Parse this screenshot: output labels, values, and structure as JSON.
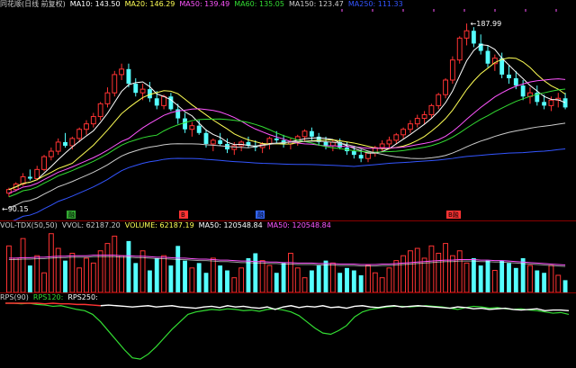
{
  "main_header": {
    "title": "同花顺(日线 前复权)",
    "indicators": [
      {
        "label": "MA10: 143.50",
        "color": "#ffffff"
      },
      {
        "label": "MA20: 146.29",
        "color": "#ffff55"
      },
      {
        "label": "MA50: 139.49",
        "color": "#ff55ff"
      },
      {
        "label": "MA60: 135.05",
        "color": "#33dd33"
      },
      {
        "label": "MA150: 123.47",
        "color": "#cccccc"
      },
      {
        "label": "MA250: 111.33",
        "color": "#3355ff"
      }
    ]
  },
  "price_labels": {
    "high": "187.99",
    "low": "90.15"
  },
  "markers": [
    {
      "label": "融",
      "color": "#33aa33"
    },
    {
      "label": "B",
      "color": "#ff3333"
    },
    {
      "label": "融",
      "color": "#3366ff"
    },
    {
      "label": "B融",
      "color": "#ff3333"
    }
  ],
  "vol_header": [
    {
      "label": "VOL-TDX(50,50)",
      "color": "#cccccc"
    },
    {
      "label": "VVOL: 62187.20",
      "color": "#cccccc"
    },
    {
      "label": "VOLUME: 62187.19",
      "color": "#ffff55"
    },
    {
      "label": "MA50: 120548.84",
      "color": "#ffffff"
    },
    {
      "label": "MA50: 120548.84",
      "color": "#ff55ff"
    }
  ],
  "rps_header": [
    {
      "label": "RPS(90)",
      "color": "#cccccc"
    },
    {
      "label": "RPS120:",
      "color": "#33dd33"
    },
    {
      "label": "RPS250:",
      "color": "#ffffff"
    }
  ],
  "colors": {
    "up": "#ff3333",
    "down": "#55ffff",
    "separator": "#8b0000"
  },
  "chart_data": {
    "type": "candlestick",
    "ylim": [
      85,
      192
    ],
    "candles": [
      [
        95,
        98,
        93,
        97
      ],
      [
        97,
        101,
        96,
        100
      ],
      [
        100,
        106,
        99,
        104
      ],
      [
        104,
        108,
        102,
        103
      ],
      [
        103,
        110,
        102,
        108
      ],
      [
        108,
        116,
        107,
        115
      ],
      [
        115,
        120,
        113,
        118
      ],
      [
        118,
        125,
        116,
        123
      ],
      [
        123,
        128,
        120,
        121
      ],
      [
        121,
        126,
        119,
        125
      ],
      [
        125,
        131,
        123,
        130
      ],
      [
        130,
        135,
        127,
        133
      ],
      [
        133,
        139,
        131,
        137
      ],
      [
        137,
        145,
        135,
        144
      ],
      [
        144,
        153,
        142,
        150
      ],
      [
        150,
        162,
        148,
        160
      ],
      [
        160,
        166,
        157,
        163
      ],
      [
        163,
        166,
        153,
        155
      ],
      [
        155,
        158,
        148,
        150
      ],
      [
        150,
        155,
        146,
        152
      ],
      [
        152,
        156,
        145,
        147
      ],
      [
        147,
        151,
        141,
        143
      ],
      [
        143,
        149,
        141,
        148
      ],
      [
        148,
        150,
        140,
        141
      ],
      [
        141,
        144,
        133,
        136
      ],
      [
        136,
        139,
        128,
        130
      ],
      [
        130,
        134,
        126,
        132
      ],
      [
        132,
        135,
        127,
        128
      ],
      [
        128,
        130,
        120,
        122
      ],
      [
        122,
        125,
        118,
        124
      ],
      [
        124,
        128,
        121,
        122
      ],
      [
        122,
        125,
        117,
        119
      ],
      [
        119,
        123,
        116,
        121
      ],
      [
        121,
        124,
        118,
        123
      ],
      [
        123,
        126,
        120,
        121
      ],
      [
        121,
        124,
        118,
        120
      ],
      [
        120,
        123,
        117,
        122
      ],
      [
        122,
        126,
        119,
        125
      ],
      [
        125,
        129,
        122,
        124
      ],
      [
        124,
        127,
        120,
        122
      ],
      [
        122,
        125,
        119,
        123
      ],
      [
        123,
        127,
        121,
        126
      ],
      [
        126,
        130,
        123,
        129
      ],
      [
        129,
        131,
        124,
        126
      ],
      [
        126,
        128,
        121,
        123
      ],
      [
        123,
        126,
        119,
        121
      ],
      [
        121,
        124,
        118,
        123
      ],
      [
        123,
        125,
        119,
        120
      ],
      [
        120,
        123,
        116,
        118
      ],
      [
        118,
        121,
        114,
        116
      ],
      [
        116,
        119,
        112,
        114
      ],
      [
        114,
        118,
        112,
        117
      ],
      [
        117,
        121,
        115,
        120
      ],
      [
        120,
        124,
        118,
        122
      ],
      [
        122,
        126,
        120,
        124
      ],
      [
        124,
        128,
        122,
        127
      ],
      [
        127,
        131,
        125,
        130
      ],
      [
        130,
        135,
        128,
        133
      ],
      [
        133,
        138,
        131,
        136
      ],
      [
        136,
        140,
        133,
        138
      ],
      [
        138,
        144,
        136,
        143
      ],
      [
        143,
        150,
        141,
        149
      ],
      [
        149,
        158,
        147,
        157
      ],
      [
        157,
        170,
        155,
        168
      ],
      [
        168,
        181,
        166,
        180
      ],
      [
        180,
        188,
        176,
        184
      ],
      [
        184,
        186,
        175,
        177
      ],
      [
        177,
        182,
        171,
        173
      ],
      [
        173,
        176,
        164,
        166
      ],
      [
        166,
        171,
        162,
        169
      ],
      [
        169,
        172,
        158,
        160
      ],
      [
        160,
        165,
        155,
        158
      ],
      [
        158,
        162,
        152,
        154
      ],
      [
        154,
        157,
        146,
        148
      ],
      [
        148,
        153,
        144,
        150
      ],
      [
        150,
        154,
        143,
        145
      ],
      [
        145,
        149,
        141,
        143
      ],
      [
        143,
        148,
        140,
        146
      ],
      [
        146,
        150,
        142,
        147
      ],
      [
        147,
        150,
        141,
        142
      ]
    ],
    "volume": [
      95,
      70,
      110,
      55,
      75,
      40,
      120,
      90,
      65,
      80,
      50,
      70,
      60,
      85,
      100,
      115,
      75,
      105,
      60,
      85,
      45,
      70,
      75,
      55,
      95,
      65,
      50,
      60,
      40,
      70,
      55,
      45,
      30,
      50,
      70,
      80,
      65,
      55,
      40,
      60,
      80,
      50,
      30,
      45,
      55,
      65,
      60,
      40,
      50,
      45,
      35,
      55,
      40,
      30,
      50,
      65,
      75,
      85,
      90,
      70,
      95,
      80,
      100,
      75,
      85,
      60,
      70,
      55,
      65,
      45,
      65,
      60,
      50,
      70,
      55,
      45,
      40,
      55,
      35,
      25
    ],
    "vol_ma": [
      70,
      70,
      71,
      71,
      72,
      72,
      73,
      74,
      74,
      75,
      75,
      75,
      76,
      76,
      76,
      76,
      75,
      75,
      74,
      74,
      73,
      72,
      72,
      71,
      70,
      70,
      69,
      68,
      68,
      67,
      66,
      66,
      65,
      64,
      64,
      63,
      63,
      62,
      62,
      61,
      61,
      60,
      60,
      60,
      59,
      59,
      59,
      58,
      58,
      58,
      57,
      57,
      57,
      58,
      58,
      59,
      60,
      61,
      62,
      63,
      64,
      65,
      66,
      66,
      67,
      67,
      67,
      66,
      66,
      65,
      65,
      64,
      63,
      62,
      61,
      60,
      59,
      58,
      57,
      56
    ],
    "rps120": [
      100,
      100,
      99,
      100,
      98,
      97,
      95,
      96,
      93,
      90,
      88,
      82,
      70,
      55,
      40,
      25,
      12,
      10,
      18,
      30,
      44,
      58,
      70,
      82,
      86,
      88,
      90,
      89,
      91,
      90,
      88,
      89,
      87,
      90,
      91,
      89,
      86,
      80,
      70,
      60,
      52,
      50,
      56,
      64,
      78,
      86,
      90,
      92,
      94,
      95,
      95,
      94,
      95,
      96,
      95,
      94,
      92,
      90,
      93,
      95,
      94,
      92,
      93,
      91,
      90,
      91,
      89,
      88,
      86,
      84,
      85,
      82
    ],
    "rps250": [
      100,
      100,
      100,
      100,
      100,
      99,
      100,
      99,
      99,
      98,
      98,
      97,
      96,
      97,
      96,
      95,
      94,
      95,
      96,
      94,
      95,
      96,
      94,
      93,
      92,
      94,
      95,
      93,
      96,
      94,
      95,
      93,
      92,
      94,
      90,
      94,
      96,
      93,
      95,
      94,
      96,
      93,
      94,
      92,
      95,
      96,
      94,
      93,
      95,
      96,
      94,
      95,
      96,
      95,
      94,
      93,
      92,
      94,
      93,
      91,
      92,
      90,
      91,
      92,
      90,
      89,
      90,
      91,
      88,
      89,
      89,
      88
    ]
  }
}
